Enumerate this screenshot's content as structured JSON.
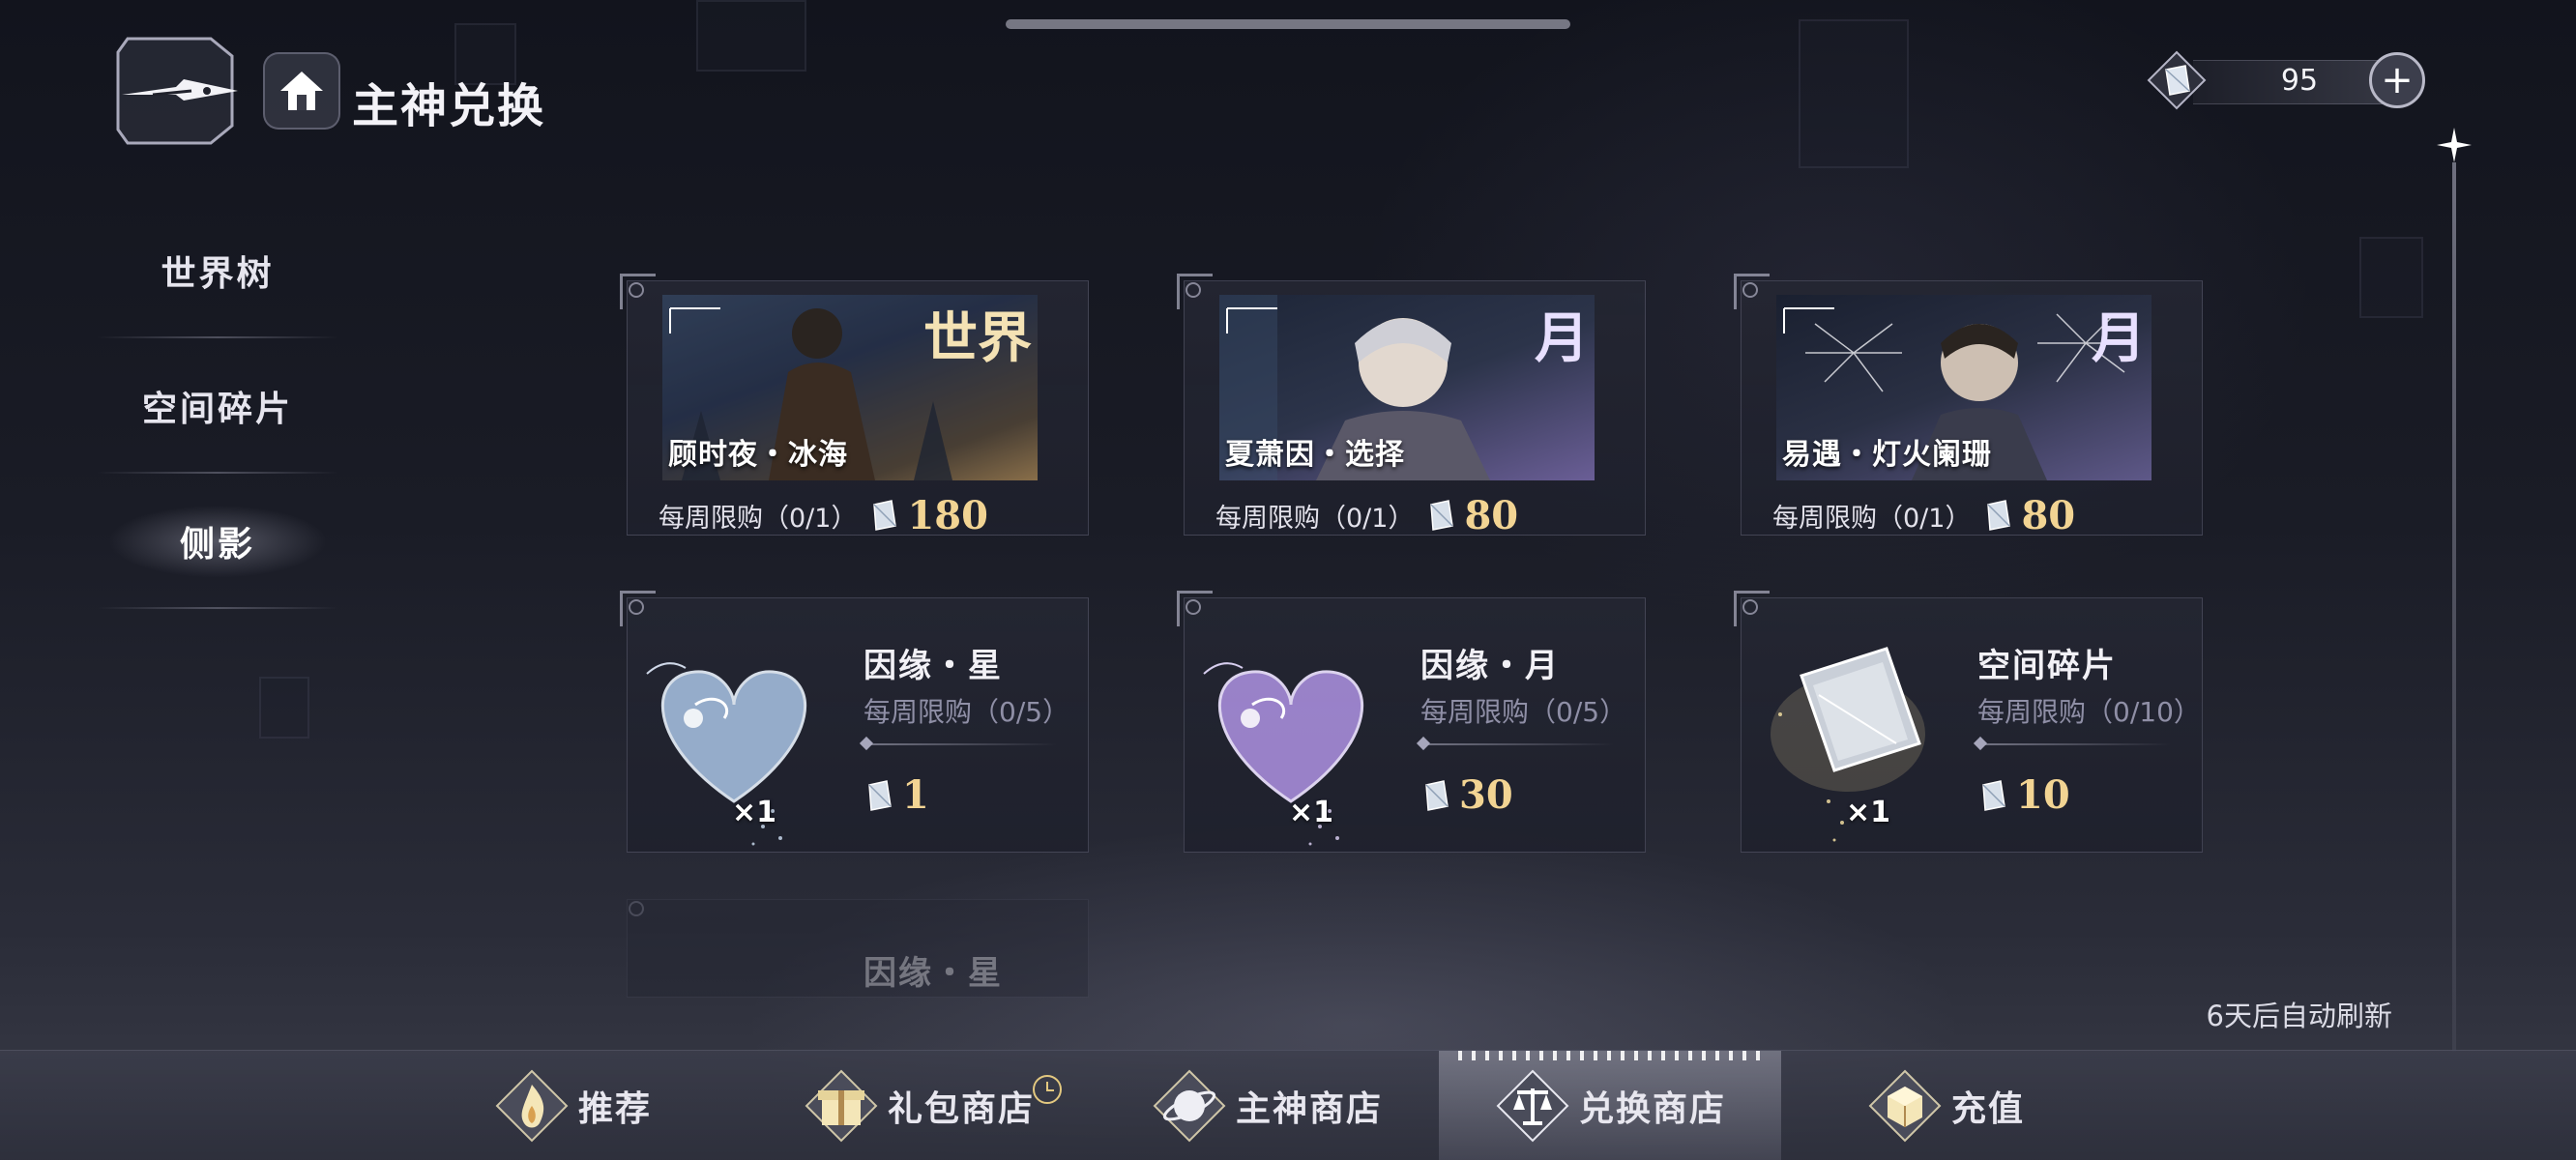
{
  "header": {
    "title": "主神兑换",
    "home_icon": "home-icon",
    "logo_icon": "feather-emblem-icon"
  },
  "currency": {
    "amount": "95",
    "add_label": "+",
    "icon": "crystal-gem-icon"
  },
  "side_nav": {
    "items": [
      {
        "label": "世界树",
        "active": false
      },
      {
        "label": "空间碎片",
        "active": false
      },
      {
        "label": "侧影",
        "active": true
      }
    ]
  },
  "cards": {
    "row1": [
      {
        "name": "顾时夜・冰海",
        "tag": "世界",
        "limit": "每周限购（0/1）",
        "price": "180"
      },
      {
        "name": "夏萧因・选择",
        "tag": "月",
        "limit": "每周限购（0/1）",
        "price": "80"
      },
      {
        "name": "易遇・灯火阑珊",
        "tag": "月",
        "limit": "每周限购（0/1）",
        "price": "80"
      }
    ],
    "row2": [
      {
        "title": "因缘・星",
        "limit": "每周限购（0/5）",
        "price": "1",
        "qty": "×1",
        "icon": "heart-crystal-blue-icon"
      },
      {
        "title": "因缘・月",
        "limit": "每周限购（0/5）",
        "price": "30",
        "qty": "×1",
        "icon": "heart-crystal-purple-icon"
      },
      {
        "title": "空间碎片",
        "limit": "每周限购（0/10）",
        "price": "10",
        "qty": "×1",
        "icon": "space-shard-icon"
      }
    ],
    "row3_partial": {
      "title": "因缘・星"
    }
  },
  "refresh_note": "6天后自动刷新",
  "bottom_tabs": [
    {
      "label": "推荐",
      "icon": "flame-icon",
      "active": false
    },
    {
      "label": "礼包商店",
      "icon": "gift-icon",
      "active": false
    },
    {
      "label": "主神商店",
      "icon": "planet-icon",
      "active": false
    },
    {
      "label": "兑换商店",
      "icon": "scales-icon",
      "active": true
    },
    {
      "label": "充值",
      "icon": "cube-icon",
      "active": false
    }
  ],
  "colors": {
    "price_gold": "#f2d493",
    "limit_gray": "#8f8fa6",
    "background": "#12141d"
  }
}
